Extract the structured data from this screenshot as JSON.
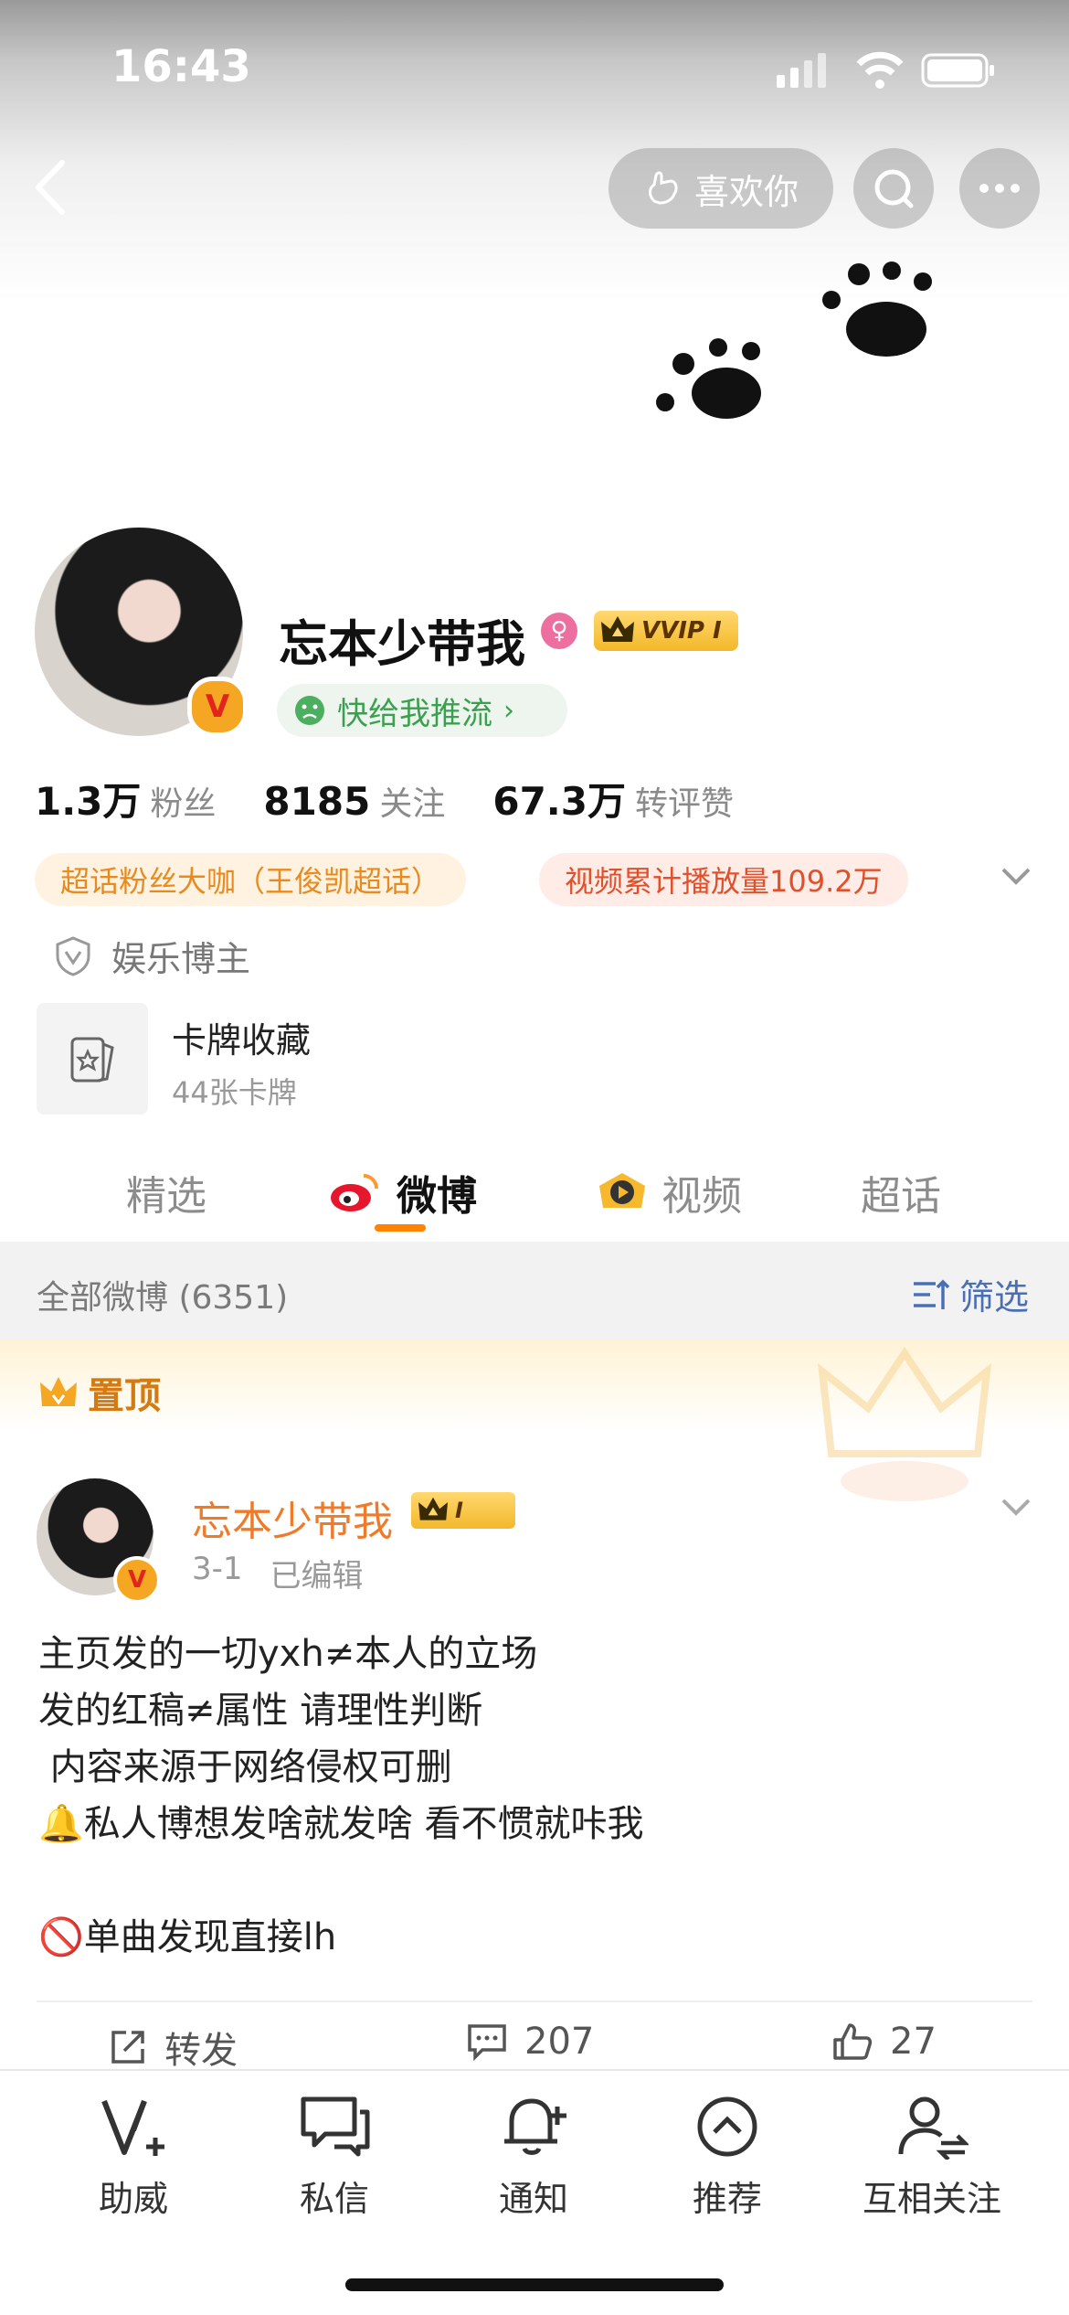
{
  "status_bar": {
    "time": "16:43"
  },
  "header": {
    "like_label": "喜欢你"
  },
  "profile": {
    "name": "忘本少带我",
    "vip_label": "VVIP Ⅰ",
    "promo_label": "快给我推流",
    "stats": [
      {
        "num": "1.3万",
        "label": "粉丝"
      },
      {
        "num": "8185",
        "label": "关注"
      },
      {
        "num": "67.3万",
        "label": "转评赞"
      }
    ],
    "tags": [
      "超话粉丝大咖（王俊凯超话）",
      "视频累计播放量109.2万"
    ],
    "category": "娱乐博主",
    "card": {
      "title": "卡牌收藏",
      "subtitle": "44张卡牌"
    }
  },
  "tabs": [
    "精选",
    "微博",
    "视频",
    "超话"
  ],
  "filter": {
    "left": "全部微博 (6351)",
    "right": "筛选"
  },
  "pinned": {
    "label": "置顶"
  },
  "post": {
    "author": "忘本少带我",
    "crown_label": "Ⅰ",
    "date": "3-1",
    "edited": "已编辑",
    "lines": [
      "主页发的一切yxh≠本人的立场",
      "发的红稿≠属性 请理性判断",
      " 内容来源于网络侵权可删",
      "🔔私人博想发啥就发啥 看不惯就咔我",
      "",
      "🚫单曲发现直接lh"
    ],
    "actions": {
      "repost": "转发",
      "comments": "207",
      "likes": "27"
    }
  },
  "bottom_nav": [
    "助威",
    "私信",
    "通知",
    "推荐",
    "互相关注"
  ]
}
